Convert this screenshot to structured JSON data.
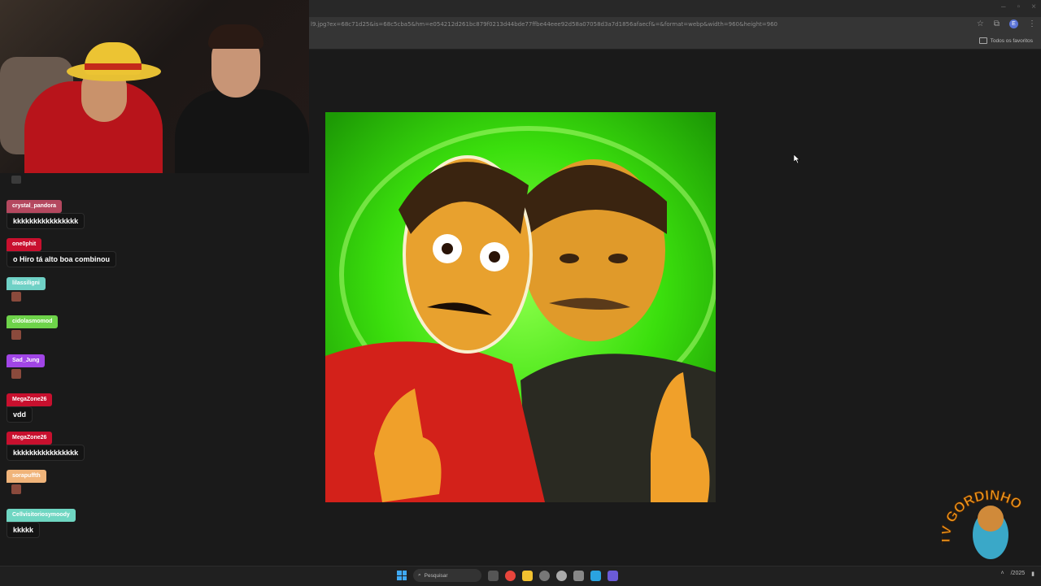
{
  "browser": {
    "url": "l9.jpg?ex=68c71d25&is=68c5cba5&hm=e054212d261bc879f0213d44bde77ffbe44eee92d58a07058d3a7d1856afaecf&=&format=webp&width=960&height=960",
    "bookmarks_all": "Todos os favoritos",
    "profile_initial": "E"
  },
  "chat": {
    "messages": [
      {
        "user": "crystal_pandora",
        "text": "kkkkkkkkkkkkkkkk",
        "color": "#b4485f"
      },
      {
        "user": "one0phit",
        "text": "o Hiro tá alto boa combinou",
        "color": "#c8102e"
      },
      {
        "user": "lilassiligni",
        "text": "",
        "color": "#6fd1c6",
        "emote": true
      },
      {
        "user": "cidolasmomod",
        "text": "",
        "color": "#6ed34a",
        "emote": true
      },
      {
        "user": "Sad_Jung",
        "text": "",
        "color": "#a145e6",
        "emote": true
      },
      {
        "user": "MegaZone26",
        "text": "vdd",
        "color": "#c8102e"
      },
      {
        "user": "MegaZone26",
        "text": "kkkkkkkkkkkkkkkk",
        "color": "#c8102e"
      },
      {
        "user": "sorapuffth",
        "text": "",
        "color": "#f0b47a",
        "emote": true
      },
      {
        "user": "Cellvisitoriosymoody",
        "text": "kkkkk",
        "color": "#6fd6c2"
      }
    ]
  },
  "watermark": {
    "text": "TV GORDINHO"
  },
  "taskbar": {
    "search_placeholder": "Pesquisar",
    "tray_time": "",
    "tray_date": "/2025"
  },
  "colors": {
    "art_green": "#3be00d",
    "shirt_red": "#d3211a"
  }
}
